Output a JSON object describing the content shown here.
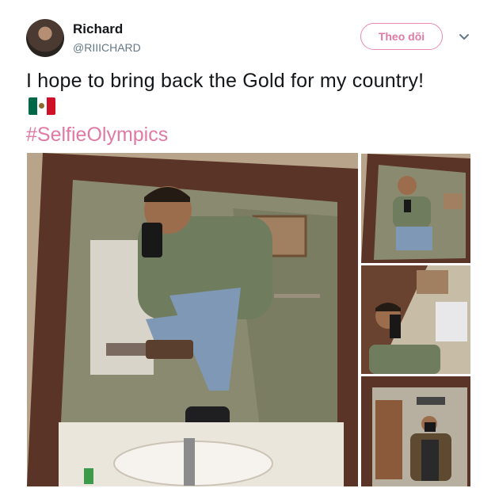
{
  "user": {
    "name": "Richard",
    "handle": "@RIIICHARD"
  },
  "follow_button": {
    "label": "Theo dõi"
  },
  "tweet": {
    "text": "I hope to bring back the Gold for my country!",
    "flag": "mexico-flag-icon",
    "hashtag": "#SelfieOlympics"
  },
  "colors": {
    "accent": "#e07aa3",
    "text": "#14171a",
    "muted": "#657786"
  }
}
